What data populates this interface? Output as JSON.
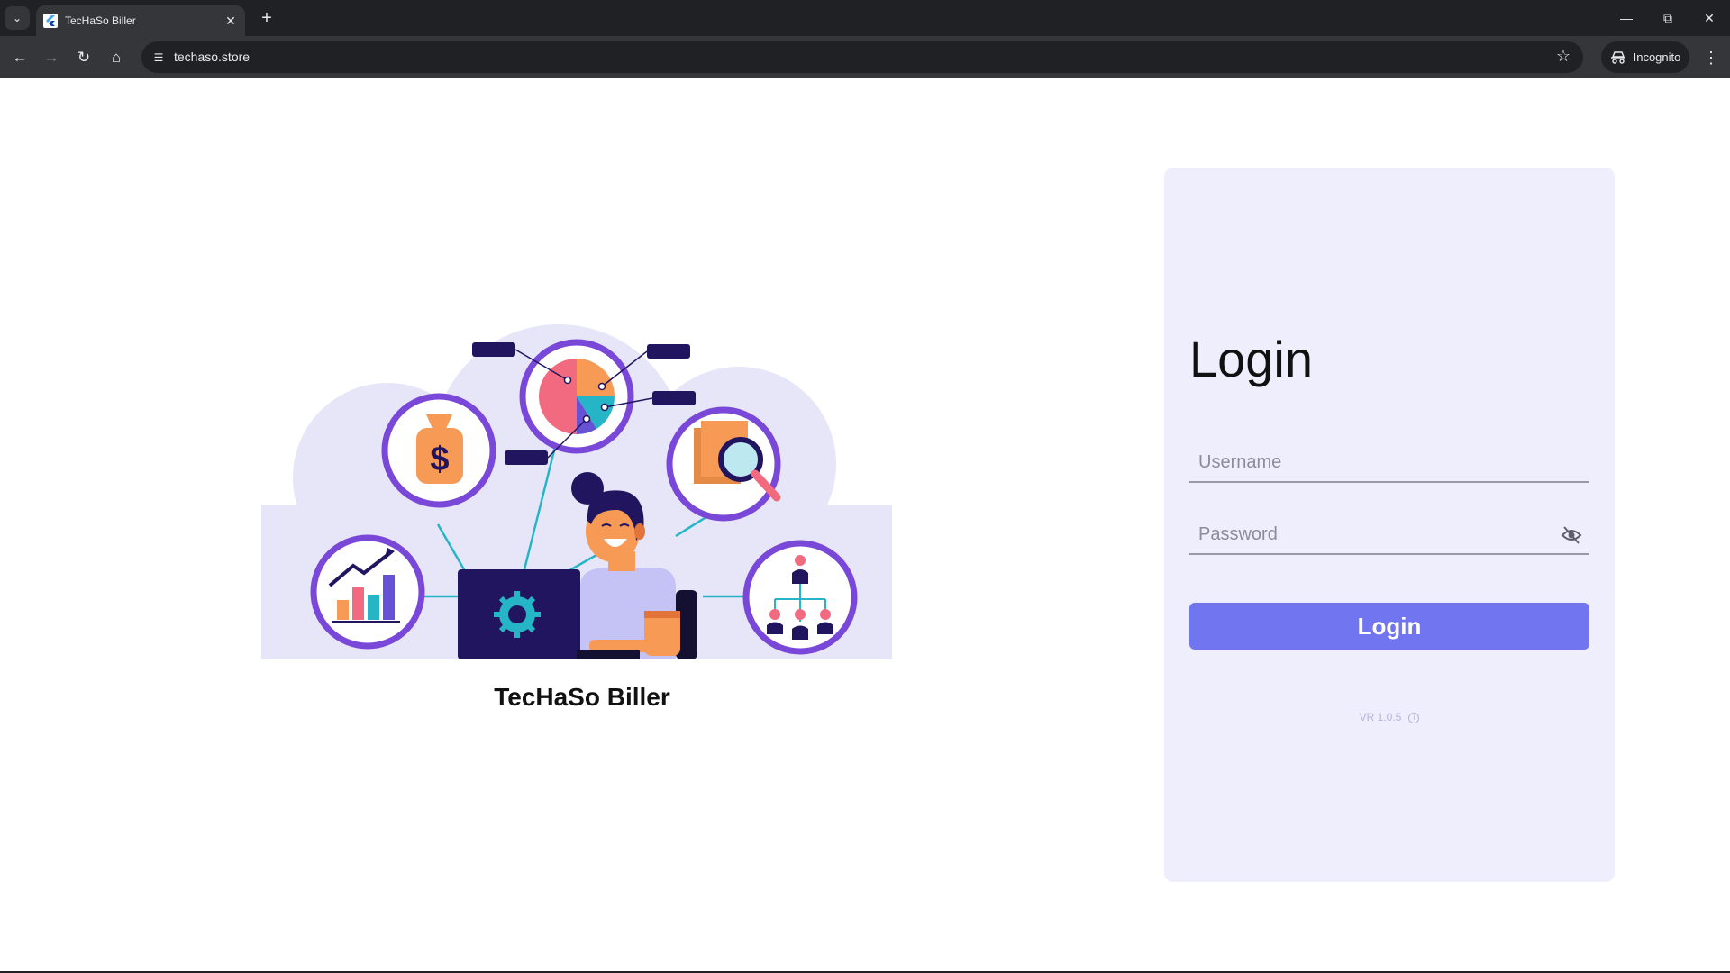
{
  "browser": {
    "tab_title": "TecHaSo Biller",
    "url": "techaso.store",
    "incognito_label": "Incognito",
    "tab_menu_icon": "chevron-down-icon",
    "close_tab_icon": "close-icon",
    "new_tab_icon": "plus-icon",
    "back_icon": "arrow-left-icon",
    "forward_icon": "arrow-right-icon",
    "reload_icon": "reload-icon",
    "home_icon": "home-icon",
    "bookmark_icon": "star-icon",
    "menu_icon": "kebab-icon"
  },
  "app": {
    "brand_name": "TecHaSo Biller",
    "accent_color": "#7175f0",
    "card_color": "#efeefc"
  },
  "login": {
    "title": "Login",
    "username_placeholder": "Username",
    "password_placeholder": "Password",
    "button_label": "Login",
    "version": "VR 1.0.5",
    "password_toggle_icon": "eye-off-icon"
  }
}
